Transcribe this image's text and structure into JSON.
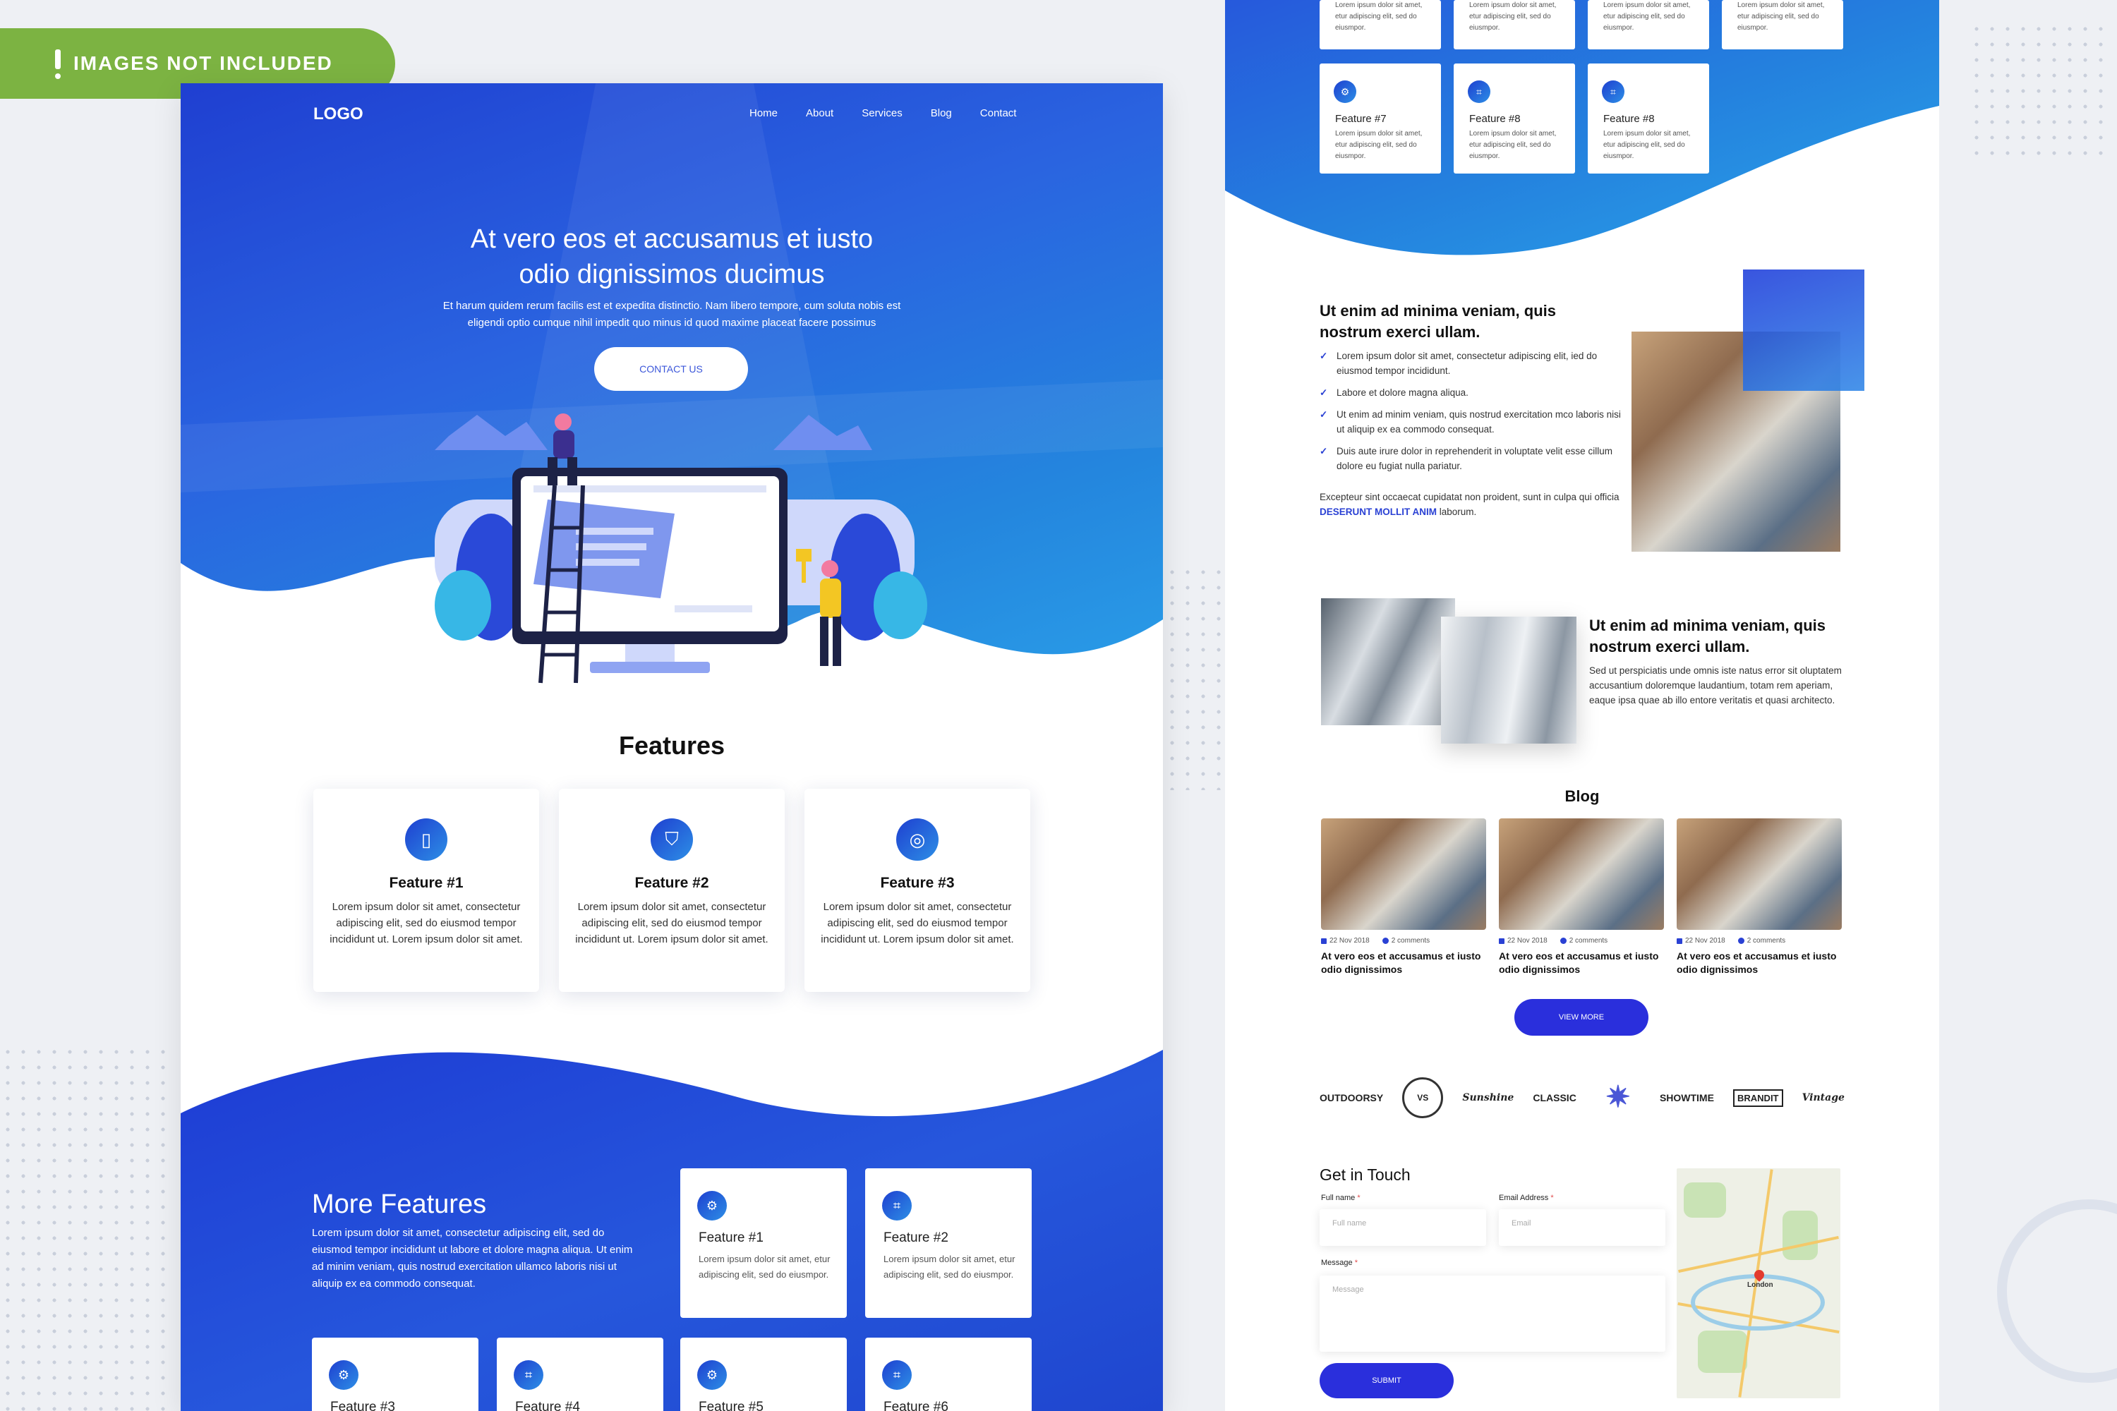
{
  "badge": {
    "text": "IMAGES NOT INCLUDED"
  },
  "left": {
    "logo": "LOGO",
    "nav": [
      "Home",
      "About",
      "Services",
      "Blog",
      "Contact"
    ],
    "hero": {
      "title_line1": "At vero eos et accusamus et iusto",
      "title_line2": "odio dignissimos ducimus",
      "sub_line1": "Et harum quidem rerum facilis est et expedita distinctio. Nam libero tempore, cum soluta nobis est",
      "sub_line2": "eligendi optio cumque nihil impedit quo minus id quod maxime placeat facere possimus",
      "button": "CONTACT US"
    },
    "features": {
      "title": "Features",
      "items": [
        {
          "title": "Feature #1",
          "text": "Lorem ipsum dolor sit amet, consectetur adipiscing elit, sed do eiusmod tempor incididunt ut. Lorem ipsum dolor sit amet."
        },
        {
          "title": "Feature #2",
          "text": "Lorem ipsum dolor sit amet, consectetur adipiscing elit, sed do eiusmod tempor incididunt ut. Lorem ipsum dolor sit amet."
        },
        {
          "title": "Feature #3",
          "text": "Lorem ipsum dolor sit amet, consectetur adipiscing elit, sed do eiusmod tempor incididunt ut. Lorem ipsum dolor sit amet."
        }
      ]
    },
    "more": {
      "title": "More Features",
      "text": "Lorem ipsum dolor sit amet, consectetur adipiscing elit, sed do eiusmod tempor incididunt ut labore et dolore magna aliqua. Ut enim ad minim veniam, quis nostrud exercitation ullamco laboris nisi ut aliquip ex ea commodo consequat.",
      "cards": [
        {
          "title": "Feature #1",
          "text": "Lorem ipsum dolor sit amet, etur adipiscing elit, sed do eiusmpor."
        },
        {
          "title": "Feature #2",
          "text": "Lorem ipsum dolor sit amet, etur adipiscing elit, sed do eiusmpor."
        },
        {
          "title": "Feature #3"
        },
        {
          "title": "Feature #4"
        },
        {
          "title": "Feature #5"
        },
        {
          "title": "Feature #6"
        }
      ]
    }
  },
  "right": {
    "top_cards_cut": [
      {
        "text": "Lorem ipsum dolor sit amet, etur adipiscing elit, sed do eiusmpor."
      },
      {
        "text": "Lorem ipsum dolor sit amet, etur adipiscing elit, sed do eiusmpor."
      },
      {
        "text": "Lorem ipsum dolor sit amet, etur adipiscing elit, sed do eiusmpor."
      },
      {
        "text": "Lorem ipsum dolor sit amet, etur adipiscing elit, sed do eiusmpor."
      }
    ],
    "top_cards": [
      {
        "title": "Feature #7",
        "text": "Lorem ipsum dolor sit amet, etur adipiscing elit, sed do eiusmpor."
      },
      {
        "title": "Feature #8",
        "text": "Lorem ipsum dolor sit amet, etur adipiscing elit, sed do eiusmpor."
      },
      {
        "title": "Feature #8",
        "text": "Lorem ipsum dolor sit amet, etur adipiscing elit, sed do eiusmpor."
      }
    ],
    "section1": {
      "title_line1": "Ut enim ad minima veniam, quis",
      "title_line2": "nostrum exerci ullam.",
      "checks": [
        "Lorem ipsum dolor sit amet, consectetur adipiscing elit, ied do eiusmod tempor incididunt.",
        "Labore et dolore magna aliqua.",
        "Ut enim ad minim veniam, quis nostrud exercitation mco laboris nisi ut aliquip ex ea commodo consequat.",
        "Duis aute irure dolor in reprehenderit in voluptate velit esse cillum dolore eu fugiat nulla pariatur."
      ],
      "para_start": "Excepteur sint occaecat cupidatat non proident, sunt in culpa qui officia ",
      "para_link": "DESERUNT MOLLIT ANIM",
      "para_end": " laborum."
    },
    "section2": {
      "title_line1": "Ut enim ad minima veniam, quis",
      "title_line2": "nostrum exerci ullam.",
      "text": "Sed ut perspiciatis unde omnis iste natus error sit oluptatem accusantium doloremque laudantium, totam rem aperiam, eaque ipsa quae ab illo entore veritatis et quasi architecto."
    },
    "blog": {
      "title": "Blog",
      "posts": [
        {
          "date": "22 Nov 2018",
          "comments": "2 comments",
          "title": "At vero eos et accusamus et iusto odio dignissimos"
        },
        {
          "date": "22 Nov 2018",
          "comments": "2 comments",
          "title": "At vero eos et accusamus et iusto odio dignissimos"
        },
        {
          "date": "22 Nov 2018",
          "comments": "2 comments",
          "title": "At vero eos et accusamus et iusto odio dignissimos"
        }
      ],
      "view_more": "VIEW MORE"
    },
    "brands": [
      "OUTDOORSY",
      "VS",
      "Sunshine",
      "CLASSIC",
      "✷",
      "SHOWTIME",
      "BRANDIT",
      "Vintage"
    ],
    "contact": {
      "title": "Get in Touch",
      "full_name_label": "Full name",
      "full_name_placeholder": "Full name",
      "email_label": "Email Address",
      "email_placeholder": "Email",
      "message_label": "Message",
      "message_placeholder": "Message",
      "required_mark": "*",
      "submit": "SUBMIT",
      "map_city": "London"
    }
  }
}
